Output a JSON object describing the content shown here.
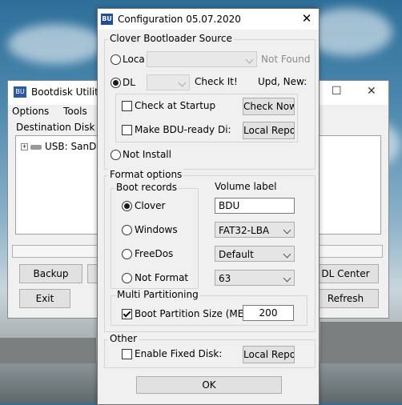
{
  "background_window": {
    "title": "Bootdisk Utility",
    "menu": [
      "Options",
      "Tools",
      "H"
    ],
    "destination_label": "Destination Disk",
    "tree_node": "USB: SanD",
    "buttons": {
      "backup": "Backup",
      "exit": "Exit",
      "dl_center": "DL Center",
      "refresh": "Refresh"
    }
  },
  "dialog": {
    "title": "Configuration 05.07.2020",
    "clover_source": {
      "legend": "Clover Bootloader Source",
      "local_label": "Loca",
      "not_found": "Not Found",
      "dl_label": "DL",
      "check_it": "Check It!",
      "upd_new": "Upd, New:",
      "check_at_startup": "Check at Startup",
      "check_now": "Check Now",
      "make_bdu_ready": "Make BDU-ready Di:",
      "local_repo_1": "Local Repo",
      "not_install": "Not Install"
    },
    "format_options": {
      "legend": "Format options",
      "boot_records_legend": "Boot records",
      "boot_records": [
        "Clover",
        "Windows",
        "FreeDos",
        "Not Format"
      ],
      "selected_boot_record": "Clover",
      "volume_label_title": "Volume label",
      "volume_label_value": "BDU",
      "filesystem": "FAT32-LBA",
      "cluster": "Default",
      "sectors": "63"
    },
    "multi_partitioning": {
      "legend": "Multi Partitioning",
      "boot_partition_label": "Boot Partition Size (ME",
      "boot_partition_checked": true,
      "boot_partition_value": "200"
    },
    "other": {
      "legend": "Other",
      "enable_fixed_disk": "Enable Fixed Disk:",
      "local_repo_2": "Local Repo"
    },
    "ok": "OK"
  }
}
